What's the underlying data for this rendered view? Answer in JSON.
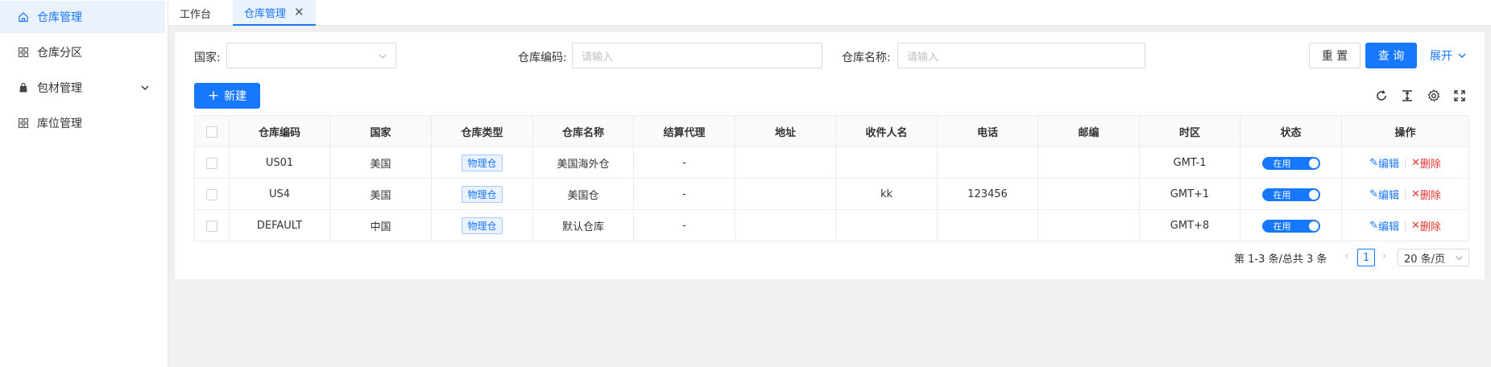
{
  "sidebar": {
    "items": [
      {
        "label": "仓库管理",
        "icon": "home-icon",
        "active": true
      },
      {
        "label": "仓库分区",
        "icon": "grid-icon",
        "active": false
      },
      {
        "label": "包材管理",
        "icon": "bag-icon",
        "active": false
      },
      {
        "label": "库位管理",
        "icon": "grid-icon",
        "active": false
      }
    ]
  },
  "tabs": [
    {
      "label": "工作台"
    },
    {
      "label": "仓库管理",
      "close": "✕"
    }
  ],
  "filters": {
    "country_label": "国家:",
    "code_label": "仓库编码:",
    "code_placeholder": "请输入",
    "name_label": "仓库名称:",
    "name_placeholder": "请输入",
    "reset_label": "重 置",
    "search_label": "查 询",
    "expand_label": "展开"
  },
  "toolbar": {
    "new_label": "新建"
  },
  "table": {
    "columns": [
      "仓库编码",
      "国家",
      "仓库类型",
      "仓库名称",
      "结算代理",
      "地址",
      "收件人名",
      "电话",
      "邮编",
      "时区",
      "状态",
      "操作"
    ],
    "rows": [
      {
        "code": "US01",
        "country": "美国",
        "type": "物理仓",
        "name": "美国海外仓",
        "agent": "-",
        "address": "",
        "recipient": "",
        "phone": "",
        "zip": "",
        "tz": "GMT-1",
        "status": "在用"
      },
      {
        "code": "US4",
        "country": "美国",
        "type": "物理仓",
        "name": "美国仓",
        "agent": "-",
        "address": "",
        "recipient": "kk",
        "phone": "123456",
        "zip": "",
        "tz": "GMT+1",
        "status": "在用"
      },
      {
        "code": "DEFAULT",
        "country": "中国",
        "type": "物理仓",
        "name": "默认仓库",
        "agent": "-",
        "address": "",
        "recipient": "",
        "phone": "",
        "zip": "",
        "tz": "GMT+8",
        "status": "在用"
      }
    ],
    "edit_label": "编辑",
    "delete_label": "删除"
  },
  "pagination": {
    "summary": "第 1-3 条/总共 3 条",
    "current_page": "1",
    "page_size": "20 条/页"
  },
  "colors": {
    "primary": "#1677ff",
    "danger": "#e5332e"
  }
}
